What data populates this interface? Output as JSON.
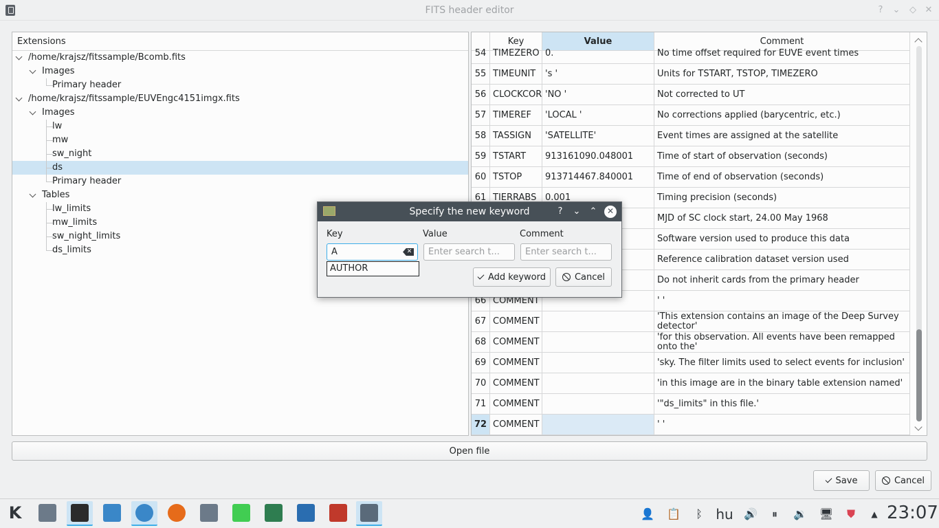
{
  "window": {
    "title": "FITS header editor",
    "buttons": [
      "?",
      "⌄",
      "◇",
      "✕"
    ]
  },
  "tree": {
    "header": "Extensions",
    "items": [
      {
        "label": "/home/krajsz/fitssample/Bcomb.fits",
        "level": 0,
        "expanded": true
      },
      {
        "label": "Images",
        "level": 1,
        "expanded": true
      },
      {
        "label": "Primary header",
        "level": 2
      },
      {
        "label": "/home/krajsz/fitssample/EUVEngc4151imgx.fits",
        "level": 0,
        "expanded": true
      },
      {
        "label": "Images",
        "level": 1,
        "expanded": true
      },
      {
        "label": "lw",
        "level": 2
      },
      {
        "label": "mw",
        "level": 2
      },
      {
        "label": "sw_night",
        "level": 2
      },
      {
        "label": "ds",
        "level": 2,
        "selected": true
      },
      {
        "label": "Primary header",
        "level": 2
      },
      {
        "label": "Tables",
        "level": 1,
        "expanded": true
      },
      {
        "label": "lw_limits",
        "level": 2
      },
      {
        "label": "mw_limits",
        "level": 2
      },
      {
        "label": "sw_night_limits",
        "level": 2
      },
      {
        "label": "ds_limits",
        "level": 2
      }
    ]
  },
  "table": {
    "columns": [
      "Key",
      "Value",
      "Comment"
    ],
    "active_column": "Value",
    "rows": [
      {
        "n": "54",
        "key": "TIMEZERO",
        "value": "0.",
        "comment": "No time offset required for EUVE event times"
      },
      {
        "n": "55",
        "key": "TIMEUNIT",
        "value": "'s '",
        "comment": "Units for TSTART, TSTOP, TIMEZERO"
      },
      {
        "n": "56",
        "key": "CLOCKCOR",
        "value": "'NO '",
        "comment": "Not corrected to UT"
      },
      {
        "n": "57",
        "key": "TIMEREF",
        "value": "'LOCAL '",
        "comment": "No corrections applied (barycentric, etc.)"
      },
      {
        "n": "58",
        "key": "TASSIGN",
        "value": "'SATELLITE'",
        "comment": "Event times are assigned at the satellite"
      },
      {
        "n": "59",
        "key": "TSTART",
        "value": "913161090.048001",
        "comment": "Time of start of observation (seconds)"
      },
      {
        "n": "60",
        "key": "TSTOP",
        "value": "913714467.840001",
        "comment": "Time of end of observation (seconds)"
      },
      {
        "n": "61",
        "key": "TIERRABS",
        "value": "0.001",
        "comment": "Timing precision (seconds)"
      },
      {
        "n": "",
        "key": "",
        "value": "",
        "comment": "MJD of SC clock start, 24.00 May 1968"
      },
      {
        "n": "",
        "key": "",
        "value": "",
        "comment": "Software version used to produce this data"
      },
      {
        "n": "",
        "key": "",
        "value": "",
        "comment": "Reference calibration dataset version used"
      },
      {
        "n": "",
        "key": "",
        "value": "",
        "comment": "Do not inherit cards from the primary header"
      },
      {
        "n": "66",
        "key": "COMMENT",
        "value": "",
        "comment": "' '"
      },
      {
        "n": "67",
        "key": "COMMENT",
        "value": "",
        "comment": "'This extension contains an image of the Deep Survey detector'"
      },
      {
        "n": "68",
        "key": "COMMENT",
        "value": "",
        "comment": "'for this observation. All events have been remapped onto the'"
      },
      {
        "n": "69",
        "key": "COMMENT",
        "value": "",
        "comment": "'sky. The filter limits used to select events for inclusion'"
      },
      {
        "n": "70",
        "key": "COMMENT",
        "value": "",
        "comment": "'in this image are in the binary table extension named'"
      },
      {
        "n": "71",
        "key": "COMMENT",
        "value": "",
        "comment": "'\"ds_limits\" in this file.'"
      },
      {
        "n": "72",
        "key": "COMMENT",
        "value": "",
        "comment": "' '",
        "selected": true
      }
    ]
  },
  "dialog": {
    "title": "Specify the new keyword",
    "title_buttons": [
      "?",
      "⌄",
      "⌃"
    ],
    "labels": {
      "key": "Key",
      "value": "Value",
      "comment": "Comment"
    },
    "key_value": "A",
    "value_placeholder": "Enter search t...",
    "comment_placeholder": "Enter search t...",
    "suggestion": "AUTHOR",
    "add_label": "Add keyword",
    "cancel_label": "Cancel"
  },
  "footer": {
    "open_label": "Open file",
    "save_label": "Save",
    "cancel_label": "Cancel"
  },
  "taskbar": {
    "apps": [
      {
        "name": "kde-menu-icon",
        "color": "#31363b"
      },
      {
        "name": "file-manager-icon",
        "color": "#6c7a89"
      },
      {
        "name": "media-player-icon",
        "color": "#2b2b2b"
      },
      {
        "name": "presentation-icon",
        "color": "#3a87c8"
      },
      {
        "name": "qbittorrent-icon",
        "color": "#3a87c8"
      },
      {
        "name": "firefox-icon",
        "color": "#e66b1a"
      },
      {
        "name": "document-viewer-icon",
        "color": "#6c7a89"
      },
      {
        "name": "qt-creator-icon",
        "color": "#41cd52"
      },
      {
        "name": "system-monitor-icon",
        "color": "#2e7d50"
      },
      {
        "name": "mail-icon",
        "color": "#2a6db0"
      },
      {
        "name": "labplot-icon",
        "color": "#c0392b"
      },
      {
        "name": "fits-editor-icon",
        "color": "#5a6a7a"
      }
    ],
    "language": "hu",
    "clock": "23:07"
  }
}
